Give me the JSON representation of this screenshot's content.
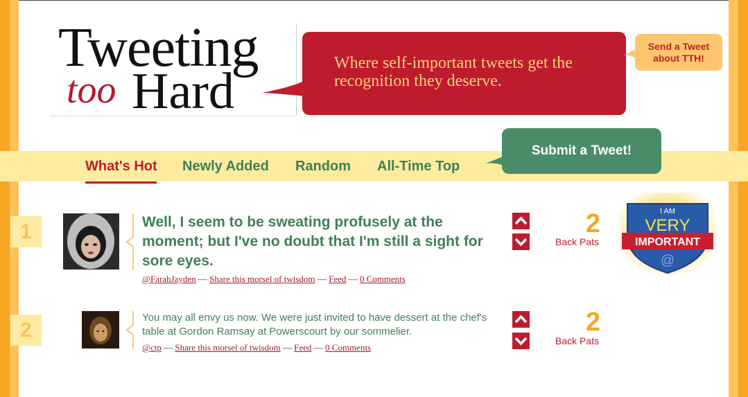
{
  "header": {
    "logo": {
      "line1": "Tweeting",
      "too": "too",
      "hard": "Hard"
    },
    "tagline": "Where self-important tweets get the recognition they deserve.",
    "send_tweet": "Send a Tweet about TTH!"
  },
  "nav": {
    "items": [
      {
        "label": "What's Hot",
        "active": true
      },
      {
        "label": "Newly Added",
        "active": false
      },
      {
        "label": "Random",
        "active": false
      },
      {
        "label": "All-Time Top",
        "active": false
      }
    ],
    "submit_label": "Submit a Tweet!"
  },
  "tweets": [
    {
      "rank": "1",
      "text": "Well, I seem to be sweating profusely at the moment; but I've no doubt that I'm still a sight for sore eyes.",
      "user": "@FarahJayden",
      "share": "Share this morsel of twisdom",
      "feed": "Feed",
      "comments": "0 Comments",
      "pats": "2",
      "pats_label": "Back Pats"
    },
    {
      "rank": "2",
      "text": "You may all envy us now. We were just invited to have dessert at the chef's table at Gordon Ramsay at Powerscourt by our sommelier.",
      "user": "@ctp",
      "share": "Share this morsel of twisdom",
      "feed": "Feed",
      "comments": "0 Comments",
      "pats": "2",
      "pats_label": "Back Pats"
    }
  ],
  "badge": {
    "line1": "I AM",
    "line2": "VERY",
    "line3": "IMPORTANT",
    "at": "@"
  },
  "colors": {
    "brand_red": "#be1b2f",
    "brand_green": "#3f7f57",
    "brand_orange": "#f6a623",
    "nav_band": "#fdeca0"
  },
  "icons": [
    "upvote-arrow-icon",
    "downvote-arrow-icon",
    "i-am-very-important-badge"
  ]
}
